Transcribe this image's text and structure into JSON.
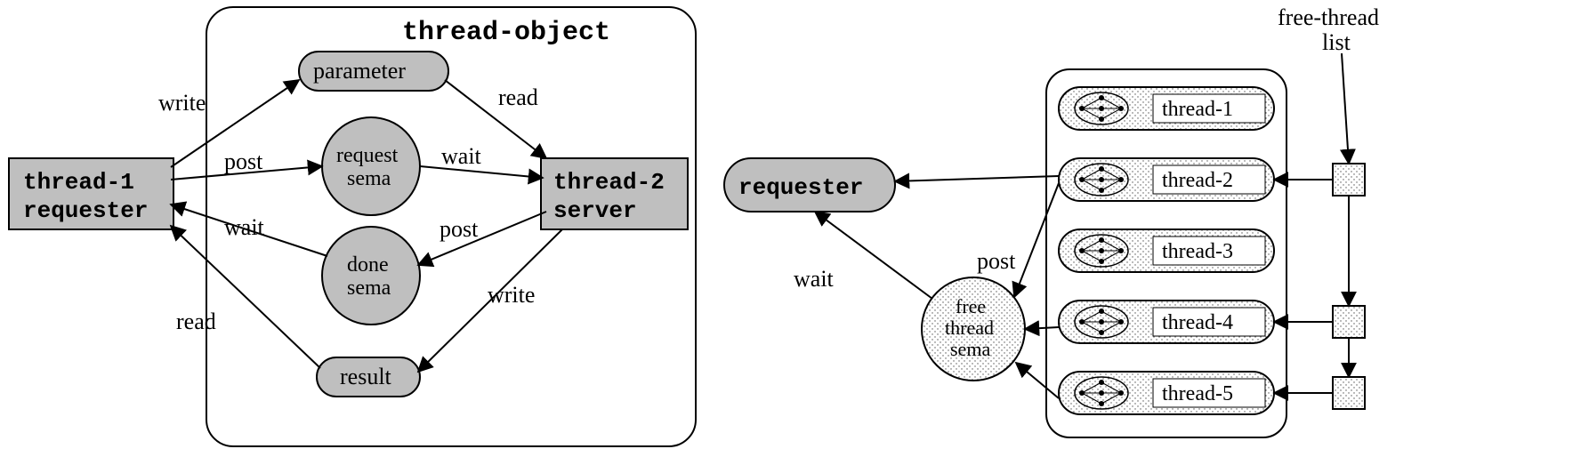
{
  "title": "thread-object",
  "left": {
    "requester": {
      "line1": "thread-1",
      "line2": "requester"
    },
    "server": {
      "line1": "thread-2",
      "line2": "server"
    },
    "parameter": "parameter",
    "request_sema": {
      "line1": "request",
      "line2": "sema"
    },
    "done_sema": {
      "line1": "done",
      "line2": "sema"
    },
    "result": "result",
    "labels": {
      "write1": "write",
      "read1": "read",
      "post1": "post",
      "wait1": "wait",
      "wait2": "wait",
      "post2": "post",
      "read2": "read",
      "write2": "write"
    }
  },
  "right": {
    "requester": "requester",
    "free_sema": {
      "line1": "free",
      "line2": "thread",
      "line3": "sema"
    },
    "wait": "wait",
    "post": "post",
    "free_thread_list": {
      "line1": "free-thread",
      "line2": "list"
    },
    "threads": [
      "thread-1",
      "thread-2",
      "thread-3",
      "thread-4",
      "thread-5"
    ]
  }
}
